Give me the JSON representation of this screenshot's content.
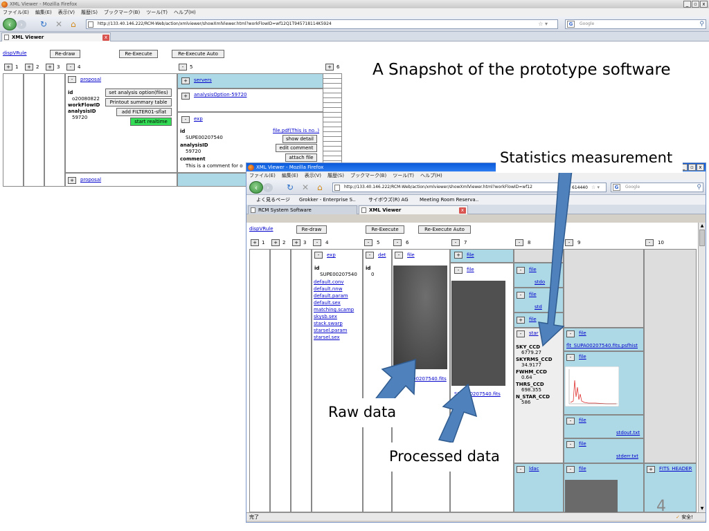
{
  "slide": {
    "title": "A Snapshot of the prototype software",
    "callout_stats": "Statistics measurement",
    "callout_raw": "Raw data",
    "callout_processed": "Processed data",
    "page_number": "4"
  },
  "back_window": {
    "title": "XML Viewer - Mozilla Firefox",
    "menu": [
      "ファイル(E)",
      "編集(E)",
      "表示(V)",
      "履歴(S)",
      "ブックマーク(B)",
      "ツール(T)",
      "ヘルプ(H)"
    ],
    "url": "http://133.40.146.222/RCM-Web/action/xmlviewer/showXmlViewer.html?workFlowID=wf12Q1T945718114K5924",
    "search_placeholder": "Google",
    "tab_label": "XML Viewer",
    "disp_link": "dispVRule",
    "buttons": {
      "redraw": "Re-draw",
      "reexec": "Re-Execute",
      "reexec_auto": "Re-Execute Auto"
    },
    "col_numbers": [
      "1",
      "2",
      "3",
      "4",
      "5",
      "6"
    ],
    "col4": {
      "proposal_link": "proposal",
      "id_label": "id",
      "id_value": "o20080822",
      "workflow_label": "workFlowID",
      "analysis_label": "analysisID",
      "analysis_value": "59720",
      "btn_set_option": "set analysis option(files)",
      "btn_printout": "Printout summary table",
      "btn_add_filter": "add FILTER01-sflat",
      "btn_start_realtime": "start realtime",
      "proposal_link2": "proposal"
    },
    "col5": {
      "servers_link": "servers",
      "analysis_option_link": "analysisOption-59720",
      "exp_link": "exp",
      "id_label": "id",
      "id_value": "SUPE00207540",
      "analysis_label": "analysisID",
      "analysis_value": "59720",
      "comment_label": "comment",
      "comment_value": "This is a comment for o",
      "file_link": "file.pdf(This is no..)",
      "btn_show_detail": "show detail",
      "btn_edit_comment": "edit comment",
      "btn_attach_file": "attach file"
    }
  },
  "front_window": {
    "title": "XML Viewer - Mozilla Firefox",
    "menu": [
      "ファイル(E)",
      "編集(E)",
      "表示(V)",
      "履歴(S)",
      "ブックマーク(B)",
      "ツール(T)",
      "ヘルプ(H)"
    ],
    "url": "http://133.40.146.222/RCM-Web/action/xmlviewer/showXmlViewer.html?workFlowID=wf12",
    "url_tail": "614440",
    "search_placeholder": "Google",
    "bookmarks": [
      "よく見るページ",
      "Grokker - Enterprise S..",
      "サイボウズ(R) AG",
      "Meeting Room Reserva.."
    ],
    "tabs": [
      "RCM System Software",
      "XML Viewer"
    ],
    "disp_link": "dispVRule",
    "buttons": {
      "redraw": "Re-draw",
      "reexec": "Re-Execute",
      "reexec_auto": "Re-Execute Auto"
    },
    "col_numbers": [
      "1",
      "2",
      "3",
      "4",
      "5",
      "6",
      "7",
      "8",
      "9",
      "10"
    ],
    "col4": {
      "exp_link": "exp",
      "id_label": "id",
      "id_value": "SUPE00207540",
      "files": [
        "default.conv",
        "default.nnw",
        "default.param",
        "default.sex",
        "matching.scamp",
        "skysb.sex",
        "stack.swarp",
        "starsel.param",
        "starsel.sex"
      ]
    },
    "col5": {
      "det_link": "det",
      "id_label": "id",
      "id_value": "0"
    },
    "col6": {
      "file_link": "file",
      "fits_link": "SUPA00207540.fits"
    },
    "col7": {
      "file_link": "file",
      "file_link2": "file",
      "fits_link": "SUPA00207540.fits"
    },
    "col8": {
      "file_link_a": "file",
      "stdout_a": "stdo",
      "file_link_b": "file",
      "stdout_b": "std",
      "file_link_c": "file",
      "star_link": "star",
      "stats": [
        {
          "label": "SKY_CCD",
          "value": "6779.27"
        },
        {
          "label": "SKYRMS_CCD",
          "value": "34.9177"
        },
        {
          "label": "FWHM_CCD",
          "value": "0.64"
        },
        {
          "label": "THRS_CCD",
          "value": "698.355"
        },
        {
          "label": "N_STAR_CCD",
          "value": "586"
        }
      ],
      "ldac_link": "ldac"
    },
    "col9": {
      "file_link_1": "file",
      "psfhist_link": "flt_SUPA00207540.fits.psfhist",
      "file_link_2": "file",
      "file_link_3": "file",
      "stdout_link": "stdout.txt",
      "file_link_4": "file",
      "stderr_link": "stderr.txt",
      "file_link_5": "file"
    },
    "col10": {
      "fits_header_link": "FITS_HEADER"
    },
    "status_text": "完了",
    "status_secure": "安全!"
  },
  "colors": {
    "cell_blue": "#add8e6",
    "arrow_fill": "#4f81bd",
    "arrow_stroke": "#2f5b8f",
    "start_button": "#33dd55"
  }
}
